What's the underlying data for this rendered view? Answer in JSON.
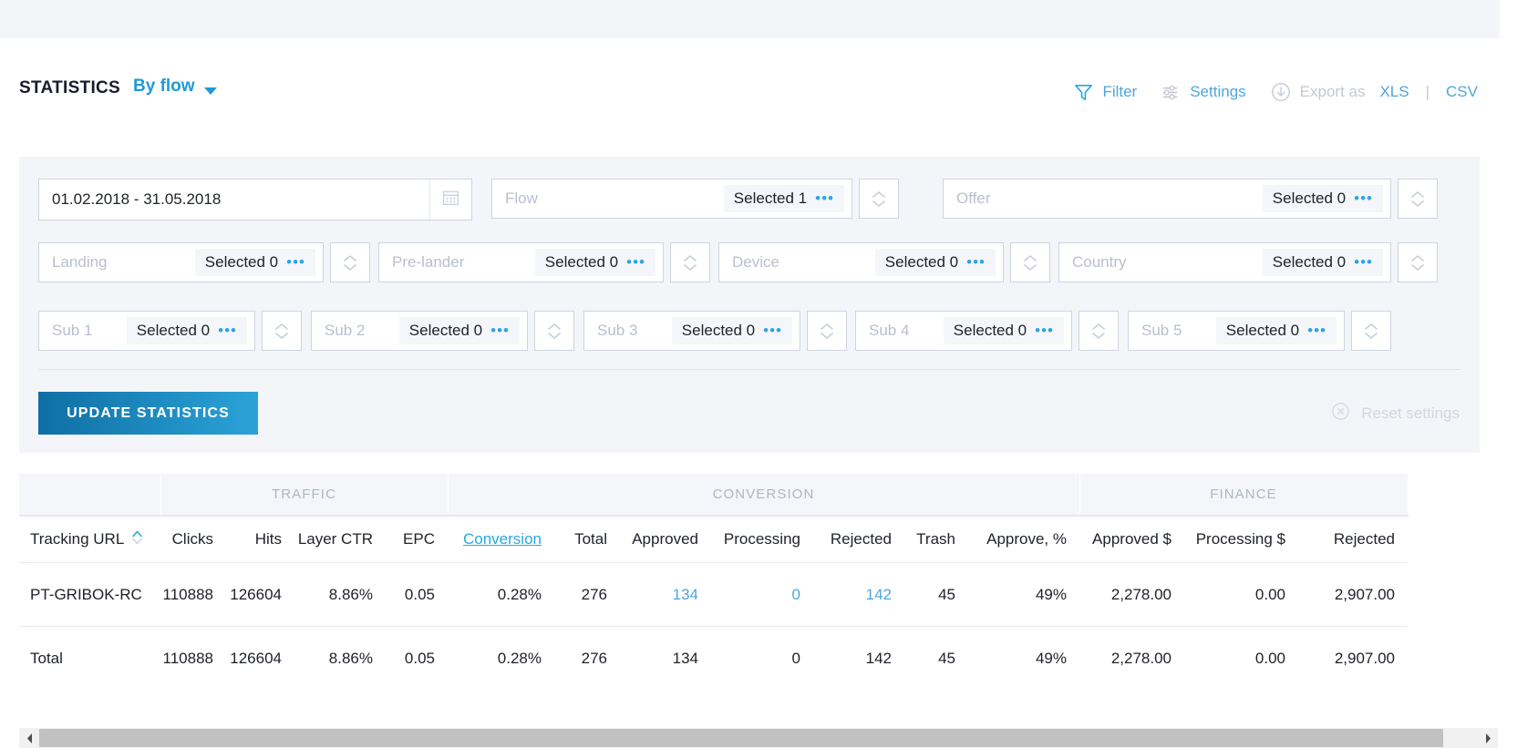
{
  "header": {
    "title": "STATISTICS",
    "mode_label": "By flow",
    "mode_caret": "chevron-down-icon",
    "actions": {
      "filter": "Filter",
      "settings": "Settings",
      "export_prefix": "Export as",
      "export_xls": "XLS",
      "separator": "|",
      "export_csv": "CSV"
    }
  },
  "filters": {
    "date": {
      "value": "01.02.2018 - 31.05.2018",
      "placeholder": "01.02.2018 - 31.05.2018"
    },
    "selects": [
      {
        "label": "Flow",
        "selected": "Selected 1",
        "dots": "•••"
      },
      {
        "label": "Offer",
        "selected": "Selected 0",
        "dots": "•••"
      },
      {
        "label": "Landing",
        "selected": "Selected 0",
        "dots": "•••"
      },
      {
        "label": "Pre-lander",
        "selected": "Selected 0",
        "dots": "•••"
      },
      {
        "label": "Device",
        "selected": "Selected 0",
        "dots": "•••"
      },
      {
        "label": "Country",
        "selected": "Selected 0",
        "dots": "•••"
      },
      {
        "label": "Sub 1",
        "selected": "Selected 0",
        "dots": "•••"
      },
      {
        "label": "Sub 2",
        "selected": "Selected 0",
        "dots": "•••"
      },
      {
        "label": "Sub 3",
        "selected": "Selected 0",
        "dots": "•••"
      },
      {
        "label": "Sub 4",
        "selected": "Selected 0",
        "dots": "•••"
      },
      {
        "label": "Sub 5",
        "selected": "Selected 0",
        "dots": "•••"
      }
    ],
    "update_button": "UPDATE STATISTICS",
    "reset_label": "Reset settings"
  },
  "table": {
    "group_headers": [
      {
        "label": "",
        "span": 1
      },
      {
        "label": "TRAFFIC",
        "span": 4
      },
      {
        "label": "CONVERSION",
        "span": 7
      },
      {
        "label": "FINANCE",
        "span": 3
      }
    ],
    "columns": [
      "Tracking URL",
      "Clicks",
      "Hits",
      "Layer CTR",
      "EPC",
      "Conversion",
      "Total",
      "Approved",
      "Processing",
      "Rejected",
      "Trash",
      "Approve, %",
      "Approved $",
      "Processing $",
      "Rejected"
    ],
    "sorted_column": "Tracking URL",
    "active_column": "Conversion",
    "rows": [
      {
        "tracking_url": "PT-GRIBOK-RC",
        "clicks": "110888",
        "hits": "126604",
        "layer_ctr": "8.86%",
        "epc": "0.05",
        "conversion": "0.28%",
        "total": "276",
        "approved": "134",
        "processing": "0",
        "rejected": "142",
        "trash": "45",
        "approve_pct": "49%",
        "approved_usd": "2,278.00",
        "processing_usd": "0.00",
        "rejected_usd": "2,907.00"
      }
    ],
    "total_row": {
      "tracking_url": "Total",
      "clicks": "110888",
      "hits": "126604",
      "layer_ctr": "8.86%",
      "epc": "0.05",
      "conversion": "0.28%",
      "total": "276",
      "approved": "134",
      "processing": "0",
      "rejected": "142",
      "trash": "45",
      "approve_pct": "49%",
      "approved_usd": "2,278.00",
      "processing_usd": "0.00",
      "rejected_usd": "2,907.00"
    }
  },
  "colors": {
    "accent": "#2ca6e0",
    "link": "#4da6dd",
    "panel": "#f4f5f9",
    "text": "#20232b",
    "muted": "#b9bfcd",
    "button_from": "#0f6fa4",
    "button_to": "#2ba3d8"
  }
}
